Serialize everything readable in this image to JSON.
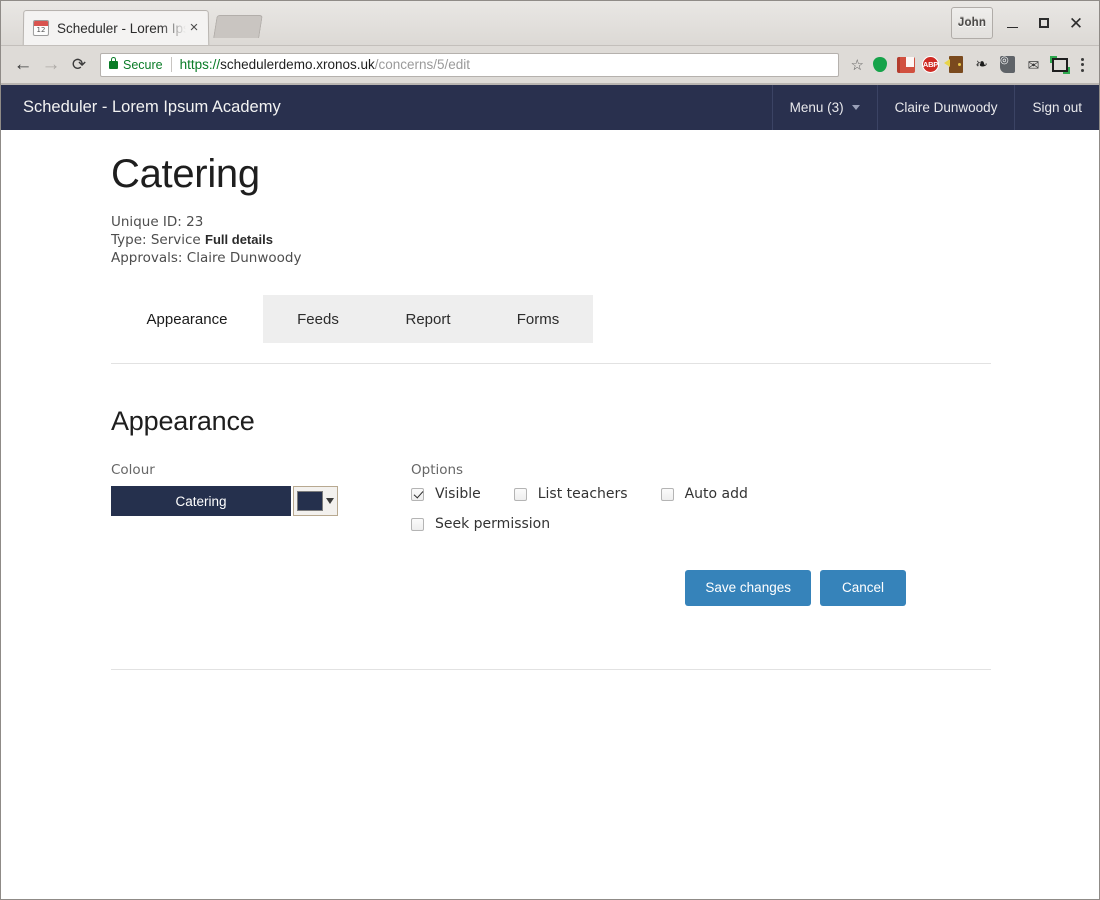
{
  "browser": {
    "tab": {
      "title": "Scheduler - Lorem Ipsum Academy",
      "favicon_name": "calendar-favicon",
      "favicon_day": "12",
      "close_glyph": "×"
    },
    "window": {
      "user_button": "John",
      "minimize_label": "Minimize",
      "maximize_label": "Maximize",
      "close_label": "Close",
      "close_glyph": "✕"
    },
    "toolbar": {
      "back_glyph": "←",
      "forward_glyph": "→",
      "reload_glyph": "⟳",
      "security_label": "Secure",
      "url_scheme": "https://",
      "url_host": "schedulerdemo.xronos.uk",
      "url_path": "/concerns/5/edit",
      "star_glyph": "☆",
      "extensions": [
        "green-balloon-icon",
        "red-book-icon",
        "adblock-plus-icon",
        "door-icon",
        "gnome-foot-icon",
        "lightbulb-note-icon",
        "mail-icon",
        "crop-capture-icon"
      ],
      "abp_label": "ABP",
      "foot_glyph": "❧",
      "bulb_glyph": "◎",
      "mail_glyph": "✉",
      "menu_label": "Customize and control"
    }
  },
  "app": {
    "brand": "Scheduler - Lorem Ipsum Academy",
    "nav": [
      {
        "label": "Menu (3)",
        "has_caret": true
      },
      {
        "label": "Claire Dunwoody",
        "has_caret": false
      },
      {
        "label": "Sign out",
        "has_caret": false
      }
    ]
  },
  "page": {
    "title": "Catering",
    "meta": {
      "unique_id_line": "Unique ID: 23",
      "type_line": "Type: Service",
      "type_link": "Full details",
      "approvals_line": "Approvals: Claire Dunwoody"
    },
    "tabs": [
      {
        "label": "Appearance",
        "active": true
      },
      {
        "label": "Feeds",
        "active": false
      },
      {
        "label": "Report",
        "active": false
      },
      {
        "label": "Forms",
        "active": false
      }
    ],
    "section_title": "Appearance",
    "colour": {
      "label": "Colour",
      "preview_text": "Catering",
      "value": "#25304d",
      "picker_name": "colour-picker-dropdown"
    },
    "options": {
      "label": "Options",
      "items": [
        {
          "label": "Visible",
          "checked": true
        },
        {
          "label": "List teachers",
          "checked": false
        },
        {
          "label": "Auto add",
          "checked": false
        },
        {
          "label": "Seek permission",
          "checked": false
        }
      ]
    },
    "actions": {
      "save": "Save changes",
      "cancel": "Cancel"
    }
  },
  "theme": {
    "navbar": "#29304e",
    "button_primary": "#3683ba",
    "colour_swatch": "#25304d",
    "secure_green": "#0a7c27"
  }
}
